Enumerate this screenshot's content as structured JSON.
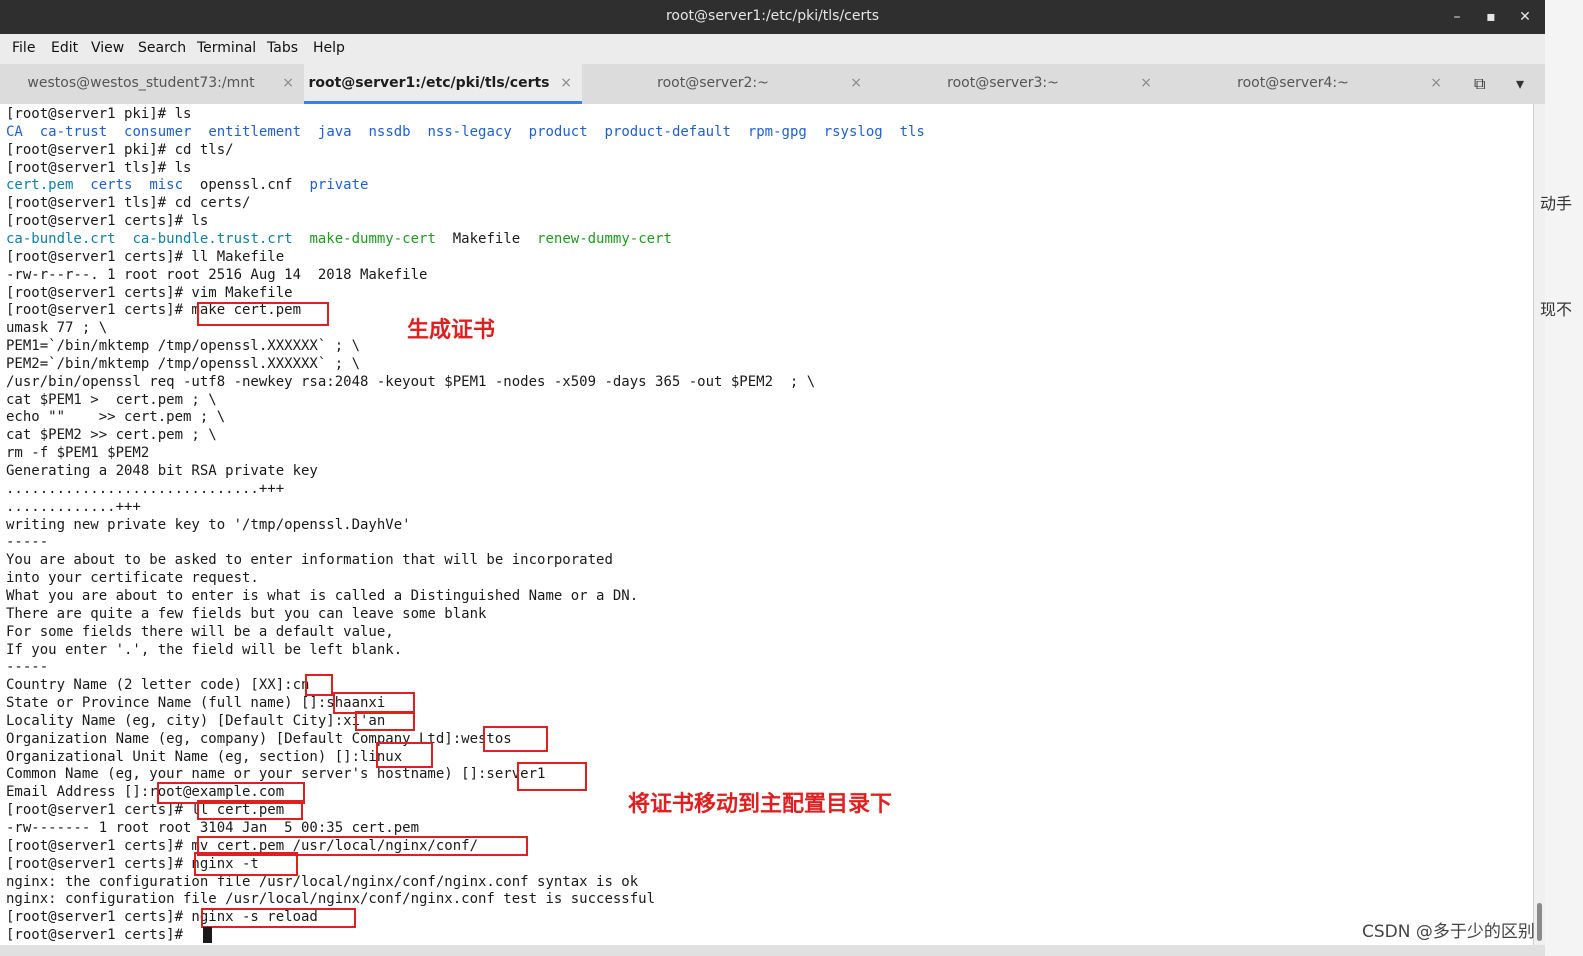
{
  "window": {
    "title": "root@server1:/etc/pki/tls/certs",
    "minimize": "–",
    "maximize": "▪",
    "close": "✕"
  },
  "menu": [
    "File",
    "Edit",
    "View",
    "Search",
    "Terminal",
    "Tabs",
    "Help"
  ],
  "tabs": [
    {
      "label": "westos@westos_student73:/mnt"
    },
    {
      "label": "root@server1:/etc/pki/tls/certs"
    },
    {
      "label": "root@server2:~"
    },
    {
      "label": "root@server3:~"
    },
    {
      "label": "root@server4:~"
    }
  ],
  "tab_close": "×",
  "tab_icons": {
    "new_tab": "⧉",
    "menu": "▾"
  },
  "terminal": {
    "lines": [
      "[root@server1 pki]# ls",
      null,
      "[root@server1 pki]# cd tls/",
      "[root@server1 tls]# ls",
      null,
      "[root@server1 tls]# cd certs/",
      "[root@server1 certs]# ls",
      null,
      "[root@server1 certs]# ll Makefile",
      "-rw-r--r--. 1 root root 2516 Aug 14  2018 Makefile",
      "[root@server1 certs]# vim Makefile",
      "[root@server1 certs]# make cert.pem",
      "umask 77 ; \\",
      "PEM1=`/bin/mktemp /tmp/openssl.XXXXXX` ; \\",
      "PEM2=`/bin/mktemp /tmp/openssl.XXXXXX` ; \\",
      "/usr/bin/openssl req -utf8 -newkey rsa:2048 -keyout $PEM1 -nodes -x509 -days 365 -out $PEM2  ; \\",
      "cat $PEM1 >  cert.pem ; \\",
      "echo \"\"    >> cert.pem ; \\",
      "cat $PEM2 >> cert.pem ; \\",
      "rm -f $PEM1 $PEM2",
      "Generating a 2048 bit RSA private key",
      "..............................+++",
      ".............+++",
      "writing new private key to '/tmp/openssl.DayhVe'",
      "-----",
      "You are about to be asked to enter information that will be incorporated",
      "into your certificate request.",
      "What you are about to enter is what is called a Distinguished Name or a DN.",
      "There are quite a few fields but you can leave some blank",
      "For some fields there will be a default value,",
      "If you enter '.', the field will be left blank.",
      "-----",
      "Country Name (2 letter code) [XX]:cn",
      "State or Province Name (full name) []:shaanxi",
      "Locality Name (eg, city) [Default City]:xi'an",
      "Organization Name (eg, company) [Default Company Ltd]:westos",
      "Organizational Unit Name (eg, section) []:linux",
      "Common Name (eg, your name or your server's hostname) []:server1",
      "Email Address []:root@example.com",
      "[root@server1 certs]# ll cert.pem",
      "-rw------- 1 root root 3104 Jan  5 00:35 cert.pem",
      "[root@server1 certs]# mv cert.pem /usr/local/nginx/conf/",
      "[root@server1 certs]# nginx -t",
      "nginx: the configuration file /usr/local/nginx/conf/nginx.conf syntax is ok",
      "nginx: configuration file /usr/local/nginx/conf/nginx.conf test is successful",
      "[root@server1 certs]# nginx -s reload",
      "[root@server1 certs]# "
    ],
    "ls_pki": [
      "CA",
      "ca-trust",
      "consumer",
      "entitlement",
      "java",
      "nssdb",
      "nss-legacy",
      "product",
      "product-default",
      "rpm-gpg",
      "rsyslog",
      "tls"
    ],
    "ls_tls": [
      {
        "name": "cert.pem",
        "color": "teal"
      },
      {
        "name": "certs",
        "color": "blue"
      },
      {
        "name": "misc",
        "color": "blue"
      },
      {
        "name": "openssl.cnf",
        "color": "plain"
      },
      {
        "name": "private",
        "color": "blue"
      }
    ],
    "ls_certs": [
      {
        "name": "ca-bundle.crt",
        "color": "teal"
      },
      {
        "name": "ca-bundle.trust.crt",
        "color": "teal"
      },
      {
        "name": "make-dummy-cert",
        "color": "green"
      },
      {
        "name": "Makefile",
        "color": "plain"
      },
      {
        "name": "renew-dummy-cert",
        "color": "green"
      }
    ]
  },
  "annotations": {
    "generate_cert": "生成证书",
    "move_cert": "将证书移动到主配置目录下"
  },
  "watermark": "CSDN @多于少的区别",
  "right_strip": {
    "a": "动手",
    "b": "现不"
  }
}
